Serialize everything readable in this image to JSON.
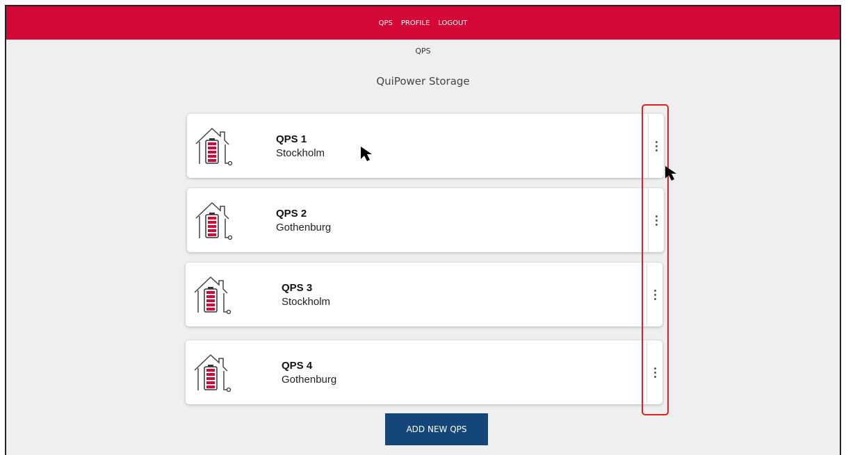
{
  "nav": {
    "items": [
      {
        "label": "QPS"
      },
      {
        "label": "PROFILE"
      },
      {
        "label": "LOGOUT"
      }
    ]
  },
  "breadcrumb": "QPS",
  "page_title": "QuiPower Storage",
  "qps_list": [
    {
      "name": "QPS 1",
      "city": "Stockholm"
    },
    {
      "name": "QPS 2",
      "city": "Gothenburg"
    },
    {
      "name": "QPS 3",
      "city": "Stockholm"
    },
    {
      "name": "QPS 4",
      "city": "Gothenburg"
    }
  ],
  "add_button_label": "ADD NEW QPS",
  "colors": {
    "brand_red": "#d40836",
    "button_blue": "#15467a",
    "highlight_red": "#e02020"
  },
  "icons": {
    "card_icon": "house-battery-icon",
    "menu_icon": "more-vertical-icon",
    "cursor": "mouse-cursor-icon"
  }
}
